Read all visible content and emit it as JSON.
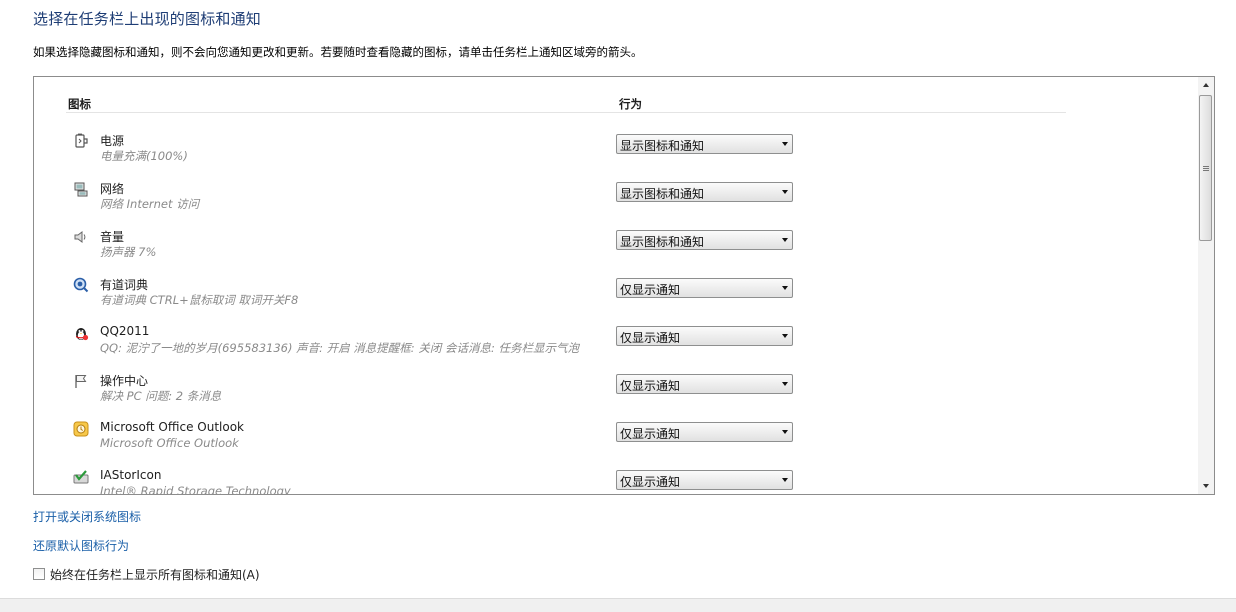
{
  "page": {
    "title": "选择在任务栏上出现的图标和通知",
    "description": "如果选择隐藏图标和通知，则不会向您通知更改和更新。若要随时查看隐藏的图标，请单击任务栏上通知区域旁的箭头。"
  },
  "table": {
    "col_icon": "图标",
    "col_behavior": "行为",
    "rows": [
      {
        "icon": "power-icon",
        "name": "电源",
        "desc": "电量充满(100%)",
        "behavior": "显示图标和通知"
      },
      {
        "icon": "network-icon",
        "name": "网络",
        "desc": "网络 Internet 访问",
        "behavior": "显示图标和通知"
      },
      {
        "icon": "speaker-icon",
        "name": "音量",
        "desc": "扬声器 7%",
        "behavior": "显示图标和通知"
      },
      {
        "icon": "youdao-dict-icon",
        "name": "有道词典",
        "desc": "有道词典   CTRL+鼠标取词   取词开关F8",
        "behavior": "仅显示通知"
      },
      {
        "icon": "qq-penguin-icon",
        "name": "QQ2011",
        "desc": "QQ: 泥泞了一地的岁月(695583136)  声音: 开启  消息提醒框: 关闭  会话消息: 任务栏显示气泡",
        "behavior": "仅显示通知"
      },
      {
        "icon": "action-center-flag-icon",
        "name": "操作中心",
        "desc": "解决 PC 问题: 2 条消息",
        "behavior": "仅显示通知"
      },
      {
        "icon": "outlook-icon",
        "name": "Microsoft Office Outlook",
        "desc": "Microsoft Office Outlook",
        "behavior": "仅显示通知"
      },
      {
        "icon": "iastor-icon",
        "name": "IAStorIcon",
        "desc": "Intel® Rapid Storage Technology",
        "behavior": "仅显示通知"
      }
    ]
  },
  "links": {
    "system_icons": "打开或关闭系统图标",
    "restore_defaults": "还原默认图标行为"
  },
  "always_show": {
    "label": "始终在任务栏上显示所有图标和通知(A)",
    "checked": false
  }
}
